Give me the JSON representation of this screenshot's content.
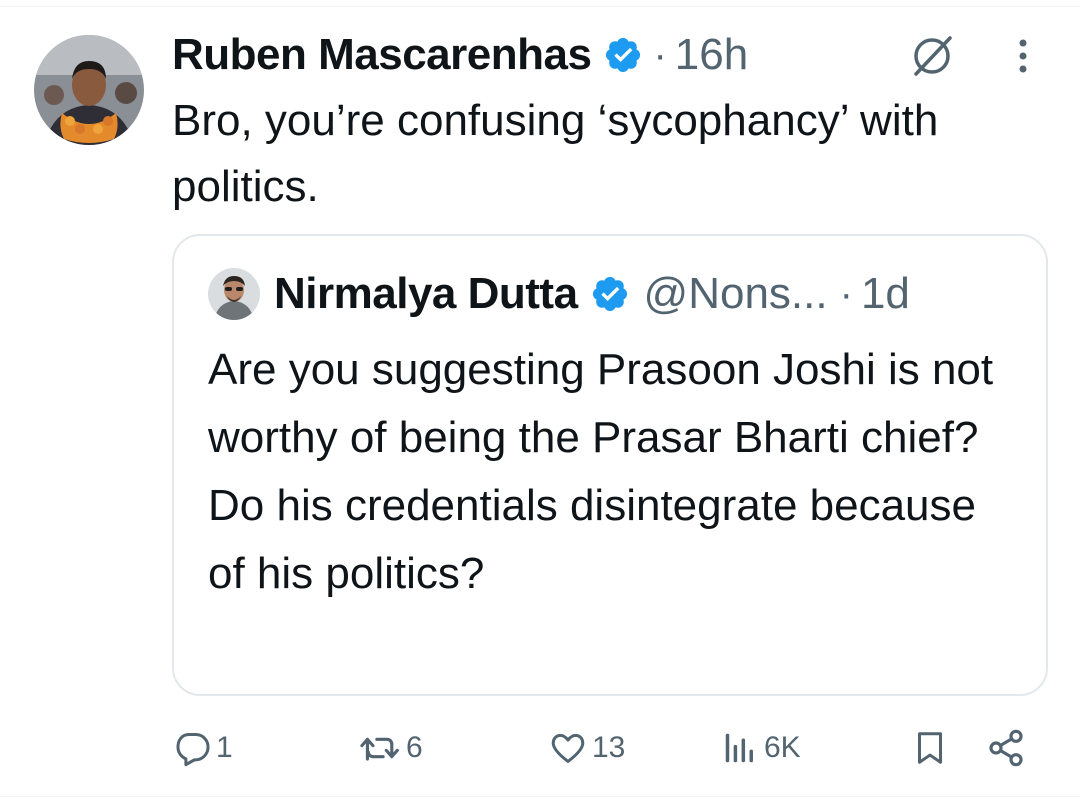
{
  "tweet": {
    "author_name": "Ruben Mascarenhas",
    "time": "16h",
    "text": "Bro, you’re confusing ‘sycophancy’ with politics."
  },
  "quote": {
    "author_name": "Nirmalya Dutta",
    "handle": "@Nons...",
    "time": "1d",
    "text": "Are you suggesting Prasoon Joshi is not worthy of being the Prasar Bharti chief? Do his credentials disintegrate because of his politics?"
  },
  "actions": {
    "replies": "1",
    "reposts": "6",
    "likes": "13",
    "views": "6K"
  },
  "separator": "·",
  "icons": {
    "verified": "verified-badge-icon",
    "grok": "grok-icon",
    "more": "more-vertical-icon",
    "reply": "reply-icon",
    "repost": "repost-icon",
    "like": "heart-icon",
    "views": "views-bar-chart-icon",
    "bookmark": "bookmark-icon",
    "share": "share-icon"
  },
  "colors": {
    "text": "#0f1419",
    "secondary": "#536471",
    "verified": "#1d9bf0",
    "border": "#e3e8ec"
  }
}
